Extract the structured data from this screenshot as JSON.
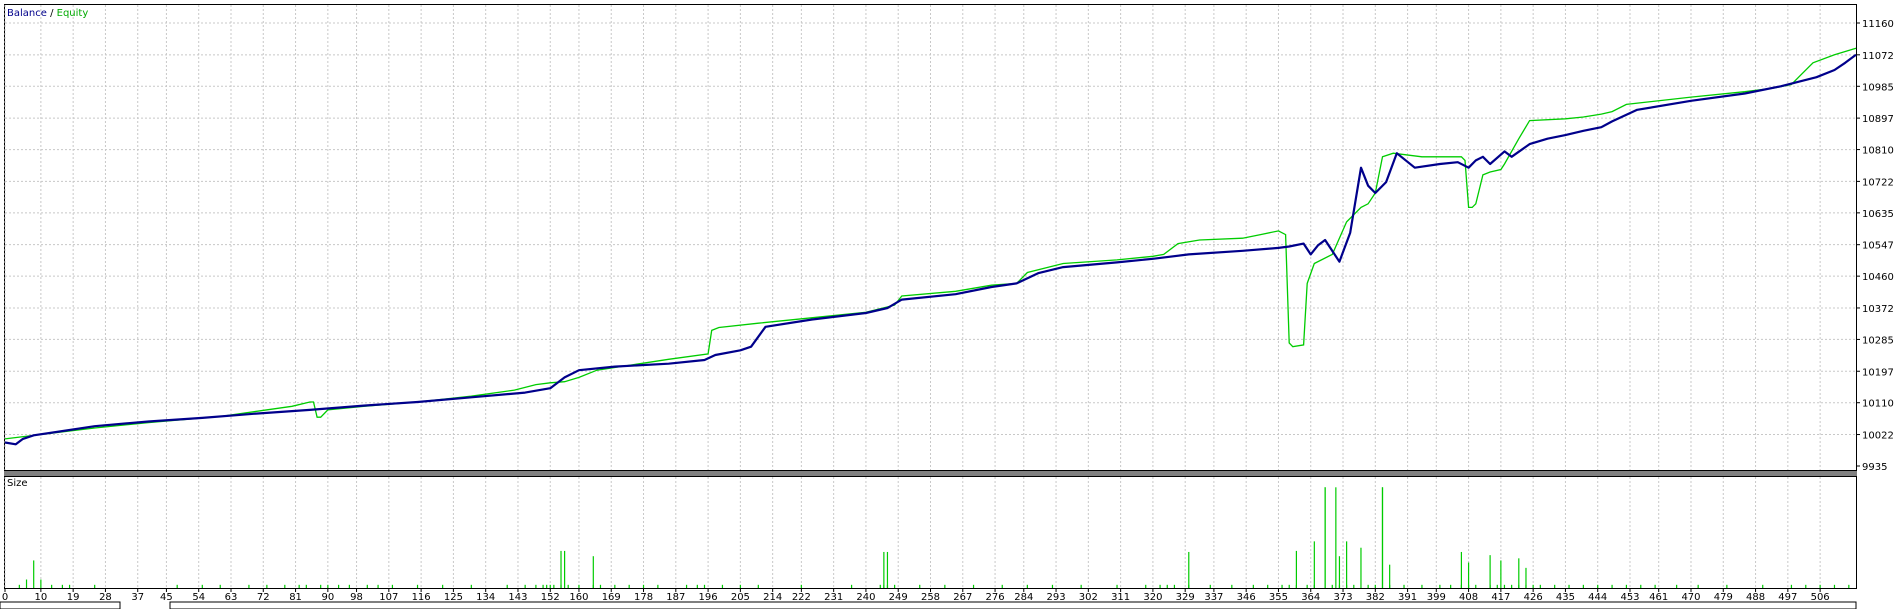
{
  "chart_data": {
    "type": "line",
    "legend": {
      "balance_label": "Balance",
      "separator": " / ",
      "equity_label": "Equity",
      "placement": "top-left"
    },
    "colors": {
      "balance": "#00008B",
      "equity": "#00CC00",
      "size": "#00CC00",
      "grid": "#C8C8C8"
    },
    "y_ticks": [
      11160,
      11072,
      10985,
      10897,
      10810,
      10722,
      10635,
      10547,
      10460,
      10372,
      10285,
      10197,
      10110,
      10022,
      9935
    ],
    "ylim": [
      9935,
      11160
    ],
    "x_ticks": [
      0,
      10,
      19,
      28,
      37,
      45,
      54,
      63,
      72,
      81,
      90,
      98,
      107,
      116,
      125,
      134,
      143,
      152,
      160,
      169,
      178,
      187,
      196,
      205,
      214,
      222,
      231,
      240,
      249,
      258,
      267,
      276,
      284,
      293,
      302,
      311,
      320,
      329,
      337,
      346,
      355,
      364,
      373,
      382,
      391,
      399,
      408,
      417,
      426,
      435,
      444,
      453,
      461,
      470,
      479,
      488,
      497,
      506
    ],
    "xlim": [
      0,
      516
    ],
    "grid": true,
    "series": [
      {
        "name": "Balance",
        "x": [
          0,
          3,
          5,
          8,
          15,
          25,
          40,
          55,
          70,
          85,
          100,
          115,
          130,
          145,
          152,
          156,
          160,
          170,
          185,
          195,
          198,
          205,
          208,
          212,
          225,
          240,
          246,
          250,
          265,
          275,
          282,
          288,
          295,
          310,
          320,
          330,
          345,
          355,
          358,
          362,
          364,
          366,
          368,
          372,
          375,
          378,
          380,
          382,
          385,
          388,
          393,
          400,
          405,
          408,
          410,
          412,
          414,
          418,
          420,
          425,
          430,
          435,
          440,
          445,
          448,
          455,
          470,
          485,
          495,
          505,
          510,
          513,
          516
        ],
        "y": [
          10000,
          9995,
          10010,
          10020,
          10030,
          10045,
          10058,
          10068,
          10080,
          10090,
          10102,
          10112,
          10125,
          10138,
          10150,
          10180,
          10200,
          10210,
          10218,
          10228,
          10242,
          10255,
          10265,
          10320,
          10340,
          10358,
          10372,
          10395,
          10410,
          10430,
          10440,
          10468,
          10485,
          10498,
          10508,
          10520,
          10530,
          10538,
          10542,
          10550,
          10520,
          10545,
          10560,
          10500,
          10580,
          10760,
          10710,
          10690,
          10720,
          10800,
          10760,
          10770,
          10775,
          10760,
          10780,
          10790,
          10770,
          10805,
          10790,
          10825,
          10840,
          10850,
          10862,
          10872,
          10888,
          10920,
          10945,
          10965,
          10985,
          11010,
          11030,
          11050,
          11072
        ]
      },
      {
        "name": "Equity",
        "x": [
          0,
          10,
          25,
          40,
          60,
          80,
          85,
          86,
          87,
          88,
          90,
          100,
          115,
          130,
          142,
          148,
          152,
          156,
          160,
          165,
          185,
          196,
          197,
          199,
          210,
          240,
          248,
          250,
          265,
          275,
          282,
          285,
          295,
          310,
          320,
          323,
          327,
          333,
          345,
          350,
          355,
          357,
          358,
          359,
          362,
          363,
          365,
          370,
          374,
          378,
          380,
          382,
          384,
          387,
          395,
          406,
          407,
          408,
          409,
          410,
          412,
          414,
          417,
          418,
          422,
          425,
          435,
          440,
          445,
          448,
          452,
          470,
          485,
          493,
          498,
          500,
          504,
          510,
          516
        ],
        "y": [
          10010,
          10022,
          10040,
          10055,
          10072,
          10100,
          10112,
          10112,
          10070,
          10070,
          10090,
          10100,
          10112,
          10128,
          10145,
          10160,
          10165,
          10168,
          10180,
          10200,
          10230,
          10245,
          10310,
          10318,
          10330,
          10360,
          10380,
          10405,
          10418,
          10435,
          10440,
          10470,
          10495,
          10505,
          10515,
          10520,
          10550,
          10560,
          10565,
          10575,
          10585,
          10575,
          10275,
          10265,
          10270,
          10440,
          10495,
          10520,
          10610,
          10650,
          10660,
          10690,
          10790,
          10800,
          10790,
          10790,
          10780,
          10650,
          10650,
          10660,
          10740,
          10748,
          10755,
          10770,
          10840,
          10890,
          10895,
          10900,
          10908,
          10915,
          10935,
          10955,
          10970,
          10980,
          10990,
          11010,
          11050,
          11072,
          11090
        ]
      }
    ],
    "size_panel": {
      "label": "Size",
      "x": [
        4,
        6,
        8,
        10,
        13,
        16,
        18,
        25,
        48,
        55,
        60,
        68,
        73,
        78,
        82,
        84,
        88,
        90,
        93,
        96,
        101,
        104,
        108,
        115,
        122,
        130,
        140,
        145,
        148,
        150,
        151,
        152,
        153,
        155,
        157,
        160,
        164,
        166,
        170,
        174,
        178,
        182,
        190,
        193,
        195,
        200,
        205,
        210,
        222,
        236,
        244,
        245,
        246,
        248,
        255,
        262,
        270,
        278,
        285,
        292,
        300,
        310,
        318,
        322,
        324,
        326,
        330,
        336,
        342,
        348,
        352,
        356,
        358,
        360,
        363,
        365,
        368,
        370,
        372,
        374,
        376,
        380,
        382,
        384,
        386,
        390,
        395,
        400,
        403,
        406,
        408,
        410,
        414,
        416,
        418,
        420,
        422,
        424,
        426,
        428,
        432,
        436,
        440,
        444,
        448,
        452,
        456,
        460,
        466,
        472,
        480,
        490,
        498,
        502,
        506,
        510,
        514
      ],
      "values": [
        3,
        8,
        26,
        8,
        3,
        3,
        3,
        3,
        3,
        3,
        3,
        3,
        3,
        3,
        3,
        3,
        3,
        3,
        3,
        3,
        3,
        3,
        3,
        3,
        3,
        3,
        3,
        3,
        3,
        3,
        3,
        3,
        3,
        3,
        3,
        3,
        3,
        3,
        3,
        3,
        3,
        3,
        3,
        3,
        3,
        3,
        3,
        3,
        3,
        3,
        3,
        3,
        3,
        3,
        3,
        3,
        3,
        3,
        3,
        3,
        3,
        3,
        3,
        3,
        3,
        3,
        3,
        3,
        3,
        3,
        3,
        3,
        3,
        3,
        3,
        3,
        3,
        3,
        3,
        3,
        3,
        3,
        3,
        3,
        3,
        3,
        3,
        3,
        3,
        3,
        3,
        3,
        3,
        3,
        3,
        3,
        3,
        3,
        3,
        3,
        3,
        3,
        3,
        3,
        3,
        3,
        3,
        3,
        3,
        3,
        3,
        3,
        3,
        3,
        3,
        3,
        3
      ]
    }
  }
}
